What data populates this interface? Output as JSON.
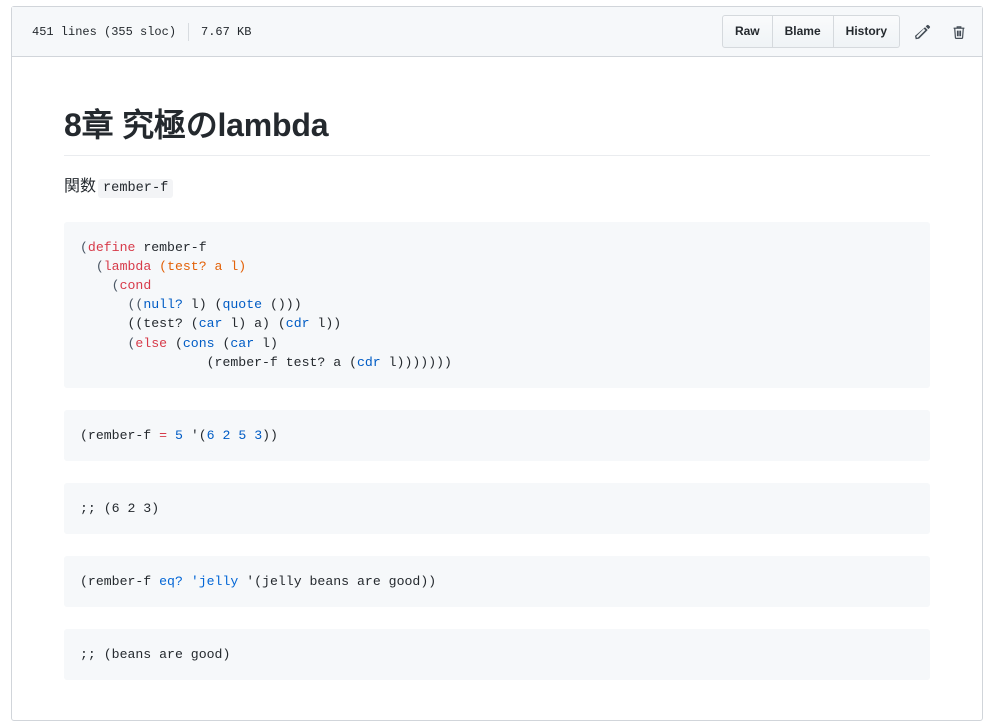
{
  "header": {
    "lines_text": "451 lines (355 sloc)",
    "size_text": "7.67 KB",
    "buttons": [
      {
        "label": "Raw",
        "name": "raw-button"
      },
      {
        "label": "Blame",
        "name": "blame-button"
      },
      {
        "label": "History",
        "name": "history-button"
      }
    ],
    "icons": [
      {
        "name": "pencil-icon",
        "title": "Edit this file"
      },
      {
        "name": "trash-icon",
        "title": "Delete this file"
      }
    ]
  },
  "document": {
    "title": "8章 究極のlambda",
    "paragraph": {
      "text": "関数",
      "code": "rember-f"
    },
    "code_blocks": [
      {
        "name": "code-block-rember-f-definition",
        "lines": [
          [
            {
              "t": "(",
              "c": "tok-punct"
            },
            {
              "t": "define",
              "c": "tok-kw"
            },
            {
              "t": " rember-f",
              "c": "tok-plain"
            }
          ],
          [
            {
              "t": "  (",
              "c": "tok-punct"
            },
            {
              "t": "lambda",
              "c": "tok-kw"
            },
            {
              "t": " ",
              "c": "tok-plain"
            },
            {
              "t": "(test? a l)",
              "c": "tok-param"
            }
          ],
          [
            {
              "t": "    (",
              "c": "tok-punct"
            },
            {
              "t": "cond",
              "c": "tok-kw"
            }
          ],
          [
            {
              "t": "      ((",
              "c": "tok-punct"
            },
            {
              "t": "null?",
              "c": "tok-fn"
            },
            {
              "t": " l) (",
              "c": "tok-plain"
            },
            {
              "t": "quote",
              "c": "tok-fn"
            },
            {
              "t": " ()))",
              "c": "tok-plain"
            }
          ],
          [
            {
              "t": "      ((test? (",
              "c": "tok-plain"
            },
            {
              "t": "car",
              "c": "tok-fn"
            },
            {
              "t": " l) a) (",
              "c": "tok-plain"
            },
            {
              "t": "cdr",
              "c": "tok-fn"
            },
            {
              "t": " l))",
              "c": "tok-plain"
            }
          ],
          [
            {
              "t": "      (",
              "c": "tok-punct"
            },
            {
              "t": "else",
              "c": "tok-kw"
            },
            {
              "t": " (",
              "c": "tok-plain"
            },
            {
              "t": "cons",
              "c": "tok-fn"
            },
            {
              "t": " (",
              "c": "tok-plain"
            },
            {
              "t": "car",
              "c": "tok-fn"
            },
            {
              "t": " l)",
              "c": "tok-plain"
            }
          ],
          [
            {
              "t": "                (rember-f test? a (",
              "c": "tok-plain"
            },
            {
              "t": "cdr",
              "c": "tok-fn"
            },
            {
              "t": " l)))))))",
              "c": "tok-plain"
            }
          ]
        ]
      },
      {
        "name": "code-block-rember-f-call-numeric",
        "lines": [
          [
            {
              "t": "(rember-f ",
              "c": "tok-plain"
            },
            {
              "t": "=",
              "c": "tok-kw"
            },
            {
              "t": " ",
              "c": "tok-plain"
            },
            {
              "t": "5",
              "c": "tok-num"
            },
            {
              "t": " '(",
              "c": "tok-plain"
            },
            {
              "t": "6",
              "c": "tok-num"
            },
            {
              "t": " ",
              "c": "tok-plain"
            },
            {
              "t": "2",
              "c": "tok-num"
            },
            {
              "t": " ",
              "c": "tok-plain"
            },
            {
              "t": "5",
              "c": "tok-num"
            },
            {
              "t": " ",
              "c": "tok-plain"
            },
            {
              "t": "3",
              "c": "tok-num"
            },
            {
              "t": "))",
              "c": "tok-plain"
            }
          ]
        ]
      },
      {
        "name": "code-block-result-numeric",
        "lines": [
          [
            {
              "t": ";; (6 2 3)",
              "c": "tok-plain"
            }
          ]
        ]
      },
      {
        "name": "code-block-rember-f-call-symbolic",
        "lines": [
          [
            {
              "t": "(rember-f ",
              "c": "tok-plain"
            },
            {
              "t": "eq?",
              "c": "tok-str"
            },
            {
              "t": " ",
              "c": "tok-plain"
            },
            {
              "t": "'jelly",
              "c": "tok-str"
            },
            {
              "t": " '(jelly beans are good))",
              "c": "tok-plain"
            }
          ]
        ]
      },
      {
        "name": "code-block-result-symbolic",
        "lines": [
          [
            {
              "t": ";; (beans are good)",
              "c": "tok-plain"
            }
          ]
        ]
      }
    ]
  }
}
